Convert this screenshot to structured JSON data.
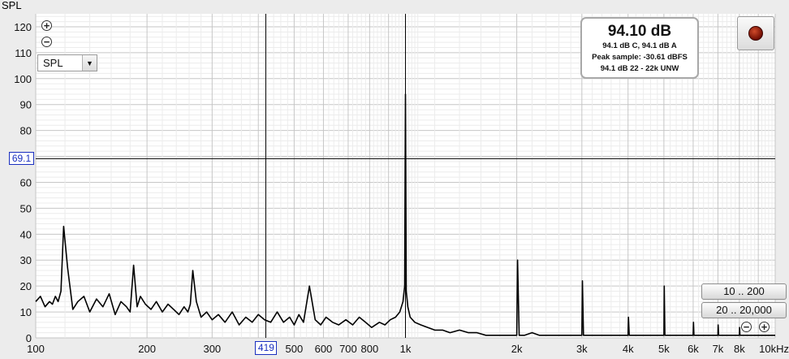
{
  "chart_data": {
    "type": "line",
    "title": "",
    "ylabel": "SPL",
    "xlabel": "",
    "x_scale": "log",
    "xlim": [
      100,
      10000
    ],
    "ylim": [
      0,
      125
    ],
    "y_ticks": [
      0,
      10,
      20,
      30,
      40,
      50,
      60,
      70,
      80,
      90,
      100,
      110,
      120
    ],
    "x_ticks": [
      {
        "value": 100,
        "label": "100"
      },
      {
        "value": 200,
        "label": "200"
      },
      {
        "value": 300,
        "label": "300"
      },
      {
        "value": 400,
        "label": "4"
      },
      {
        "value": 500,
        "label": "500"
      },
      {
        "value": 600,
        "label": "600"
      },
      {
        "value": 700,
        "label": "700"
      },
      {
        "value": 800,
        "label": "800"
      },
      {
        "value": 1000,
        "label": "1k"
      },
      {
        "value": 2000,
        "label": "2k"
      },
      {
        "value": 3000,
        "label": "3k"
      },
      {
        "value": 4000,
        "label": "4k"
      },
      {
        "value": 5000,
        "label": "5k"
      },
      {
        "value": 6000,
        "label": "6k"
      },
      {
        "value": 7000,
        "label": "7k"
      },
      {
        "value": 8000,
        "label": "8k"
      },
      {
        "value": 10000,
        "label": "10kHz"
      }
    ],
    "grid": true,
    "series": [
      {
        "color": "#000000",
        "x": [
          100,
          103,
          106,
          109,
          111,
          113,
          115,
          117,
          119,
          122,
          126,
          130,
          135,
          140,
          146,
          152,
          158,
          164,
          170,
          176,
          180,
          184,
          188,
          192,
          198,
          205,
          212,
          220,
          228,
          236,
          244,
          252,
          258,
          262,
          266,
          272,
          280,
          290,
          300,
          312,
          325,
          340,
          355,
          370,
          385,
          400,
          416,
          432,
          450,
          468,
          486,
          500,
          515,
          530,
          550,
          570,
          590,
          610,
          635,
          660,
          690,
          720,
          750,
          780,
          810,
          850,
          880,
          910,
          940,
          965,
          985,
          995,
          1000,
          1005,
          1015,
          1030,
          1060,
          1100,
          1150,
          1200,
          1260,
          1320,
          1400,
          1480,
          1560,
          1650,
          1750,
          1850,
          1950,
          2000,
          2010,
          2030,
          2100,
          2200,
          2300,
          2400,
          2500,
          2700,
          2900,
          3000,
          3010,
          3030,
          3200,
          3500,
          3800,
          4000,
          4010,
          4030,
          4300,
          4700,
          5000,
          5010,
          5030,
          5400,
          5800,
          6000,
          6010,
          6030,
          6400,
          6800,
          7000,
          7010,
          7030,
          7400,
          7800,
          8000,
          8010,
          8030,
          8500,
          9000,
          9500,
          10000
        ],
        "y": [
          14,
          16,
          12,
          14,
          13,
          16,
          14,
          18,
          43,
          27,
          11,
          14,
          16,
          10,
          15,
          12,
          17,
          9,
          14,
          12,
          10,
          28,
          12,
          16,
          13,
          11,
          14,
          10,
          13,
          11,
          9,
          12,
          10,
          13,
          26,
          14,
          8,
          10,
          7,
          9,
          6,
          10,
          5,
          8,
          6,
          9,
          7,
          6,
          10,
          6,
          8,
          5,
          9,
          6,
          20,
          7,
          5,
          8,
          6,
          5,
          7,
          5,
          8,
          6,
          4,
          6,
          5,
          7,
          8,
          10,
          14,
          20,
          94,
          18,
          12,
          8,
          6,
          5,
          4,
          3,
          3,
          2,
          3,
          2,
          2,
          1,
          1,
          1,
          1,
          1,
          30,
          1,
          1,
          2,
          1,
          1,
          1,
          1,
          1,
          1,
          22,
          1,
          1,
          1,
          1,
          1,
          8,
          1,
          1,
          1,
          1,
          20,
          1,
          1,
          1,
          1,
          6,
          1,
          1,
          1,
          1,
          5,
          1,
          1,
          1,
          1,
          4,
          1,
          1,
          1,
          1,
          1
        ]
      }
    ]
  },
  "ui": {
    "y_axis_title": "SPL",
    "select_value": "SPL",
    "select_arrow": "▼",
    "zoom_in_symbol": "+",
    "zoom_out_symbol": "−",
    "readout_big": "94.10 dB",
    "readout_line1": "94.1 dB C, 94.1 dB A",
    "readout_line2": "Peak sample: -30.61 dBFS",
    "readout_line3": "94.1 dB 22 - 22k UNW",
    "range_btn_1": "10 .. 200",
    "range_btn_2": "20 .. 20,000",
    "cursor_y_value": "69.1",
    "cursor_x_value": "419",
    "cursor_y_db": 69.1,
    "cursor_x_hz": 419,
    "marker_x_hz": 1000,
    "icons": {
      "zoom_in": "plus-circle-icon",
      "zoom_out": "minus-circle-icon",
      "record": "record-icon"
    },
    "colors": {
      "background": "#ececec",
      "plot_bg": "#ffffff",
      "grid": "#c8c8c8",
      "trace": "#000000",
      "cursor_label": "#1a2fbf"
    }
  }
}
